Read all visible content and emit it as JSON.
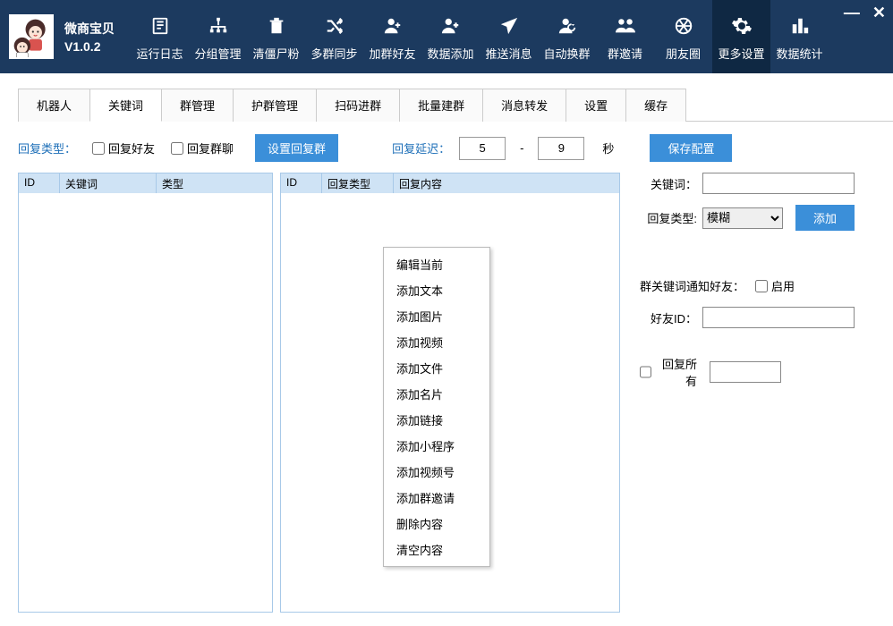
{
  "app": {
    "name": "微商宝贝",
    "version": "V1.0.2"
  },
  "toolbar": [
    {
      "label": "运行日志"
    },
    {
      "label": "分组管理"
    },
    {
      "label": "清僵尸粉"
    },
    {
      "label": "多群同步"
    },
    {
      "label": "加群好友"
    },
    {
      "label": "数据添加"
    },
    {
      "label": "推送消息"
    },
    {
      "label": "自动换群"
    },
    {
      "label": "群邀请"
    },
    {
      "label": "朋友圈"
    },
    {
      "label": "更多设置",
      "active": true
    },
    {
      "label": "数据统计"
    }
  ],
  "tabs": [
    "机器人",
    "关键词",
    "群管理",
    "护群管理",
    "扫码进群",
    "批量建群",
    "消息转发",
    "设置",
    "缓存"
  ],
  "active_tab": "关键词",
  "controls": {
    "reply_type_label": "回复类型：",
    "chk_friend": "回复好友",
    "chk_group": "回复群聊",
    "btn_set_group": "设置回复群",
    "delay_label": "回复延迟：",
    "delay_from": "5",
    "delay_to": "9",
    "seconds": "秒",
    "btn_save": "保存配置"
  },
  "table_left": {
    "headers": [
      "ID",
      "关键词",
      "类型"
    ]
  },
  "table_mid": {
    "headers": [
      "ID",
      "回复类型",
      "回复内容"
    ]
  },
  "context_menu": [
    "编辑当前",
    "添加文本",
    "添加图片",
    "添加视频",
    "添加文件",
    "添加名片",
    "添加链接",
    "添加小程序",
    "添加视频号",
    "添加群邀请",
    "删除内容",
    "清空内容"
  ],
  "side": {
    "kw_label": "关键词：",
    "type_label": "回复类型:",
    "type_value": "模糊",
    "btn_add": "添加",
    "notify_label": "群关键词通知好友：",
    "enable": "启用",
    "friend_id_label": "好友ID：",
    "reply_all": "回复所有"
  },
  "win": {
    "min": "—",
    "close": "✕"
  }
}
